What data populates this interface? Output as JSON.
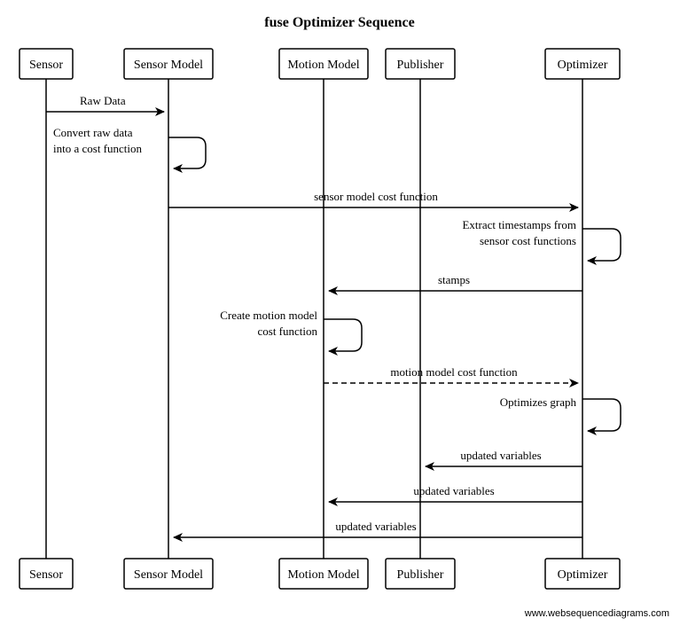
{
  "title": "fuse Optimizer Sequence",
  "participants": {
    "sensor": "Sensor",
    "sensor_model": "Sensor Model",
    "motion_model": "Motion Model",
    "publisher": "Publisher",
    "optimizer": "Optimizer"
  },
  "messages": {
    "raw_data": "Raw Data",
    "convert_1": "Convert raw data",
    "convert_2": "into a cost function",
    "sensor_cost": "sensor model cost function",
    "extract_1": "Extract timestamps from",
    "extract_2": "sensor cost functions",
    "stamps": "stamps",
    "create_1": "Create motion model",
    "create_2": "cost function",
    "motion_cost": "motion model cost function",
    "optimizes": "Optimizes graph",
    "updated_1": "updated variables",
    "updated_2": "updated variables",
    "updated_3": "updated variables"
  },
  "credit": "www.websequencediagrams.com",
  "chart_data": {
    "type": "sequence-diagram",
    "participants": [
      "Sensor",
      "Sensor Model",
      "Motion Model",
      "Publisher",
      "Optimizer"
    ],
    "interactions": [
      {
        "from": "Sensor",
        "to": "Sensor Model",
        "label": "Raw Data",
        "style": "solid"
      },
      {
        "from": "Sensor Model",
        "to": "Sensor Model",
        "label": "Convert raw data into a cost function",
        "style": "self"
      },
      {
        "from": "Sensor Model",
        "to": "Optimizer",
        "label": "sensor model cost function",
        "style": "solid"
      },
      {
        "from": "Optimizer",
        "to": "Optimizer",
        "label": "Extract timestamps from sensor cost functions",
        "style": "self"
      },
      {
        "from": "Optimizer",
        "to": "Motion Model",
        "label": "stamps",
        "style": "solid"
      },
      {
        "from": "Motion Model",
        "to": "Motion Model",
        "label": "Create motion model cost function",
        "style": "self"
      },
      {
        "from": "Motion Model",
        "to": "Optimizer",
        "label": "motion model cost function",
        "style": "dashed"
      },
      {
        "from": "Optimizer",
        "to": "Optimizer",
        "label": "Optimizes graph",
        "style": "self"
      },
      {
        "from": "Optimizer",
        "to": "Publisher",
        "label": "updated variables",
        "style": "solid"
      },
      {
        "from": "Optimizer",
        "to": "Motion Model",
        "label": "updated variables",
        "style": "solid"
      },
      {
        "from": "Optimizer",
        "to": "Sensor Model",
        "label": "updated variables",
        "style": "solid"
      }
    ]
  }
}
